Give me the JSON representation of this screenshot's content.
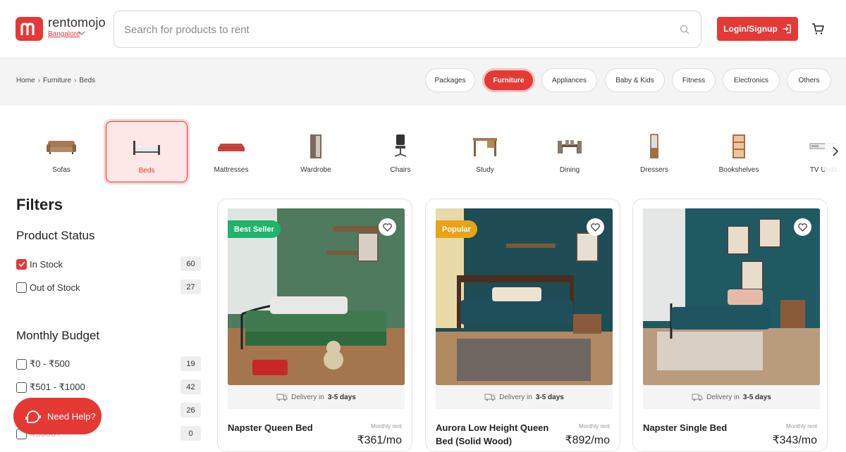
{
  "header": {
    "brand": "rentomojo",
    "city": "Bangalore",
    "search_placeholder": "Search for products to rent",
    "login_label": "Login/Signup"
  },
  "breadcrumb": [
    "Home",
    "Furniture",
    "Beds"
  ],
  "top_categories": [
    "Packages",
    "Furniture",
    "Appliances",
    "Baby & Kids",
    "Fitness",
    "Electronics",
    "Others"
  ],
  "active_top_category": "Furniture",
  "subcategories": [
    "Sofas",
    "Beds",
    "Mattresses",
    "Wardrobe",
    "Chairs",
    "Study",
    "Dining",
    "Dressers",
    "Bookshelves",
    "TV Units"
  ],
  "active_subcategory": "Beds",
  "filters": {
    "title": "Filters",
    "product_status": {
      "title": "Product Status",
      "options": [
        {
          "label": "In Stock",
          "count": "60",
          "checked": true
        },
        {
          "label": "Out of Stock",
          "count": "27",
          "checked": false
        }
      ]
    },
    "monthly_budget": {
      "title": "Monthly Budget",
      "options": [
        {
          "label": "₹0 - ₹500",
          "count": "19",
          "checked": false
        },
        {
          "label": "₹501 - ₹1000",
          "count": "42",
          "checked": false
        },
        {
          "label": "",
          "count": "26",
          "checked": false
        },
        {
          "label": "₹5000+",
          "count": "0",
          "checked": false
        }
      ]
    }
  },
  "help_label": "Need Help?",
  "products": [
    {
      "name": "Napster Queen Bed",
      "badge": "Best Seller",
      "badge_color": "#1fb36b",
      "delivery_prefix": "Delivery in",
      "delivery_days": "3-5 days",
      "price_label": "Monthly rent",
      "price": "₹361/mo",
      "wall_color": "#4f7a5e",
      "bed_color": "#3e7a4e"
    },
    {
      "name": "Aurora Low Height Queen Bed (Solid Wood)",
      "badge": "Popular",
      "badge_color": "#e8a317",
      "delivery_prefix": "Delivery in",
      "delivery_days": "3-5 days",
      "price_label": "Monthly rent",
      "price": "₹892/mo",
      "wall_color": "#1f4d55",
      "bed_color": "#1f4f5a"
    },
    {
      "name": "Napster Single Bed",
      "badge": "",
      "badge_color": "",
      "delivery_prefix": "Delivery in",
      "delivery_days": "3-5 days",
      "price_label": "Monthly rent",
      "price": "₹343/mo",
      "wall_color": "#1f5a63",
      "bed_color": "#1e5560"
    }
  ],
  "colors": {
    "accent": "#e53935"
  }
}
